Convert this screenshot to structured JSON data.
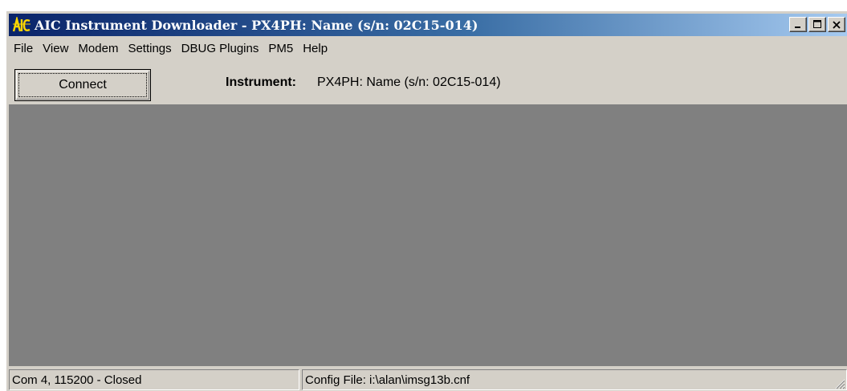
{
  "window": {
    "title": "AIC Instrument Downloader  -  PX4PH: Name (s/n: 02C15-014)",
    "app_icon": "aic-logo-icon",
    "controls": {
      "minimize": "minimize-icon",
      "maximize": "maximize-icon",
      "close": "close-icon"
    }
  },
  "menubar": {
    "items": [
      {
        "label": "File"
      },
      {
        "label": "View"
      },
      {
        "label": "Modem"
      },
      {
        "label": "Settings"
      },
      {
        "label": "DBUG Plugins"
      },
      {
        "label": "PM5"
      },
      {
        "label": "Help"
      }
    ]
  },
  "toolbar": {
    "connect_label": "Connect",
    "instrument_label": "Instrument:",
    "instrument_value": "PX4PH: Name (s/n: 02C15-014)"
  },
  "statusbar": {
    "port_status": "Com 4, 115200 - Closed",
    "config_file": "Config File: i:\\alan\\imsg13b.cnf"
  },
  "colors": {
    "title_gradient_start": "#0a246a",
    "title_gradient_end": "#a6caf0",
    "client_background": "#808080",
    "chrome": "#d4d0c8"
  }
}
